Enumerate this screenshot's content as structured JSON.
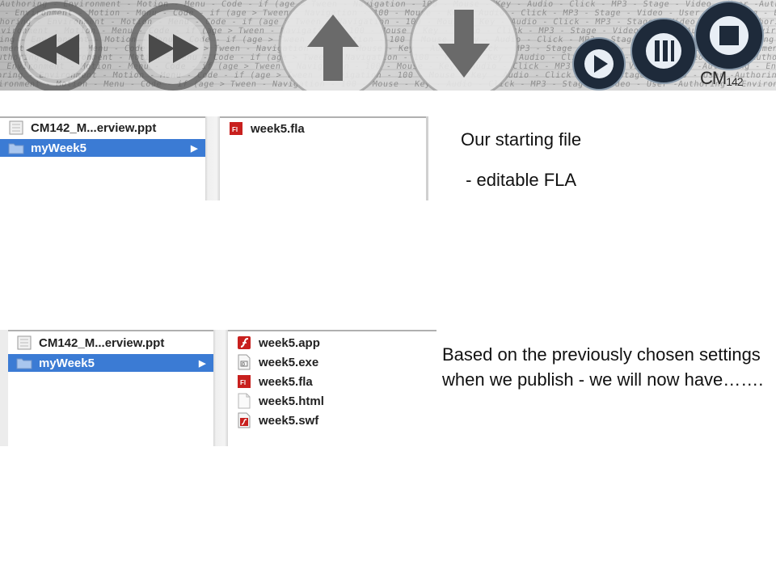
{
  "banner": {
    "logo_text": "CM",
    "logo_number": "142",
    "background_words": "Authoring - Environment - Motion - Menu - Code - if (age > Tween - Navigation - 100 - Mouse - Key - Audio - Click - MP3 - Stage - Video - User -Authoring - Environment -",
    "buttons": [
      "rewind-icon",
      "fast-forward-icon",
      "up-arrow-icon",
      "down-arrow-icon",
      "play-icon",
      "pause-icon",
      "stop-icon"
    ]
  },
  "finder_before": {
    "sidebar": [
      {
        "label": "CM142_M...erview.ppt",
        "icon": "document-icon"
      },
      {
        "label": "myWeek5",
        "icon": "folder-icon",
        "selected": true
      }
    ],
    "files": [
      {
        "label": "week5.fla",
        "icon": "fla-file-icon"
      }
    ]
  },
  "finder_after": {
    "sidebar": [
      {
        "label": "CM142_M...erview.ppt",
        "icon": "document-icon"
      },
      {
        "label": "myWeek5",
        "icon": "folder-icon",
        "selected": true
      }
    ],
    "files": [
      {
        "label": "week5.app",
        "icon": "app-file-icon"
      },
      {
        "label": "week5.exe",
        "icon": "exe-file-icon"
      },
      {
        "label": "week5.fla",
        "icon": "fla-file-icon"
      },
      {
        "label": "week5.html",
        "icon": "html-file-icon"
      },
      {
        "label": "week5.swf",
        "icon": "swf-file-icon"
      }
    ]
  },
  "text": {
    "caption_title": "Our starting file",
    "caption_sub": " - editable FLA",
    "caption_after": "Based on the previously chosen settings when we publish - we will now have……."
  },
  "colors": {
    "selection": "#3b7bd4",
    "flash_red": "#c8201e",
    "button_dark": "#1e2a3a"
  }
}
